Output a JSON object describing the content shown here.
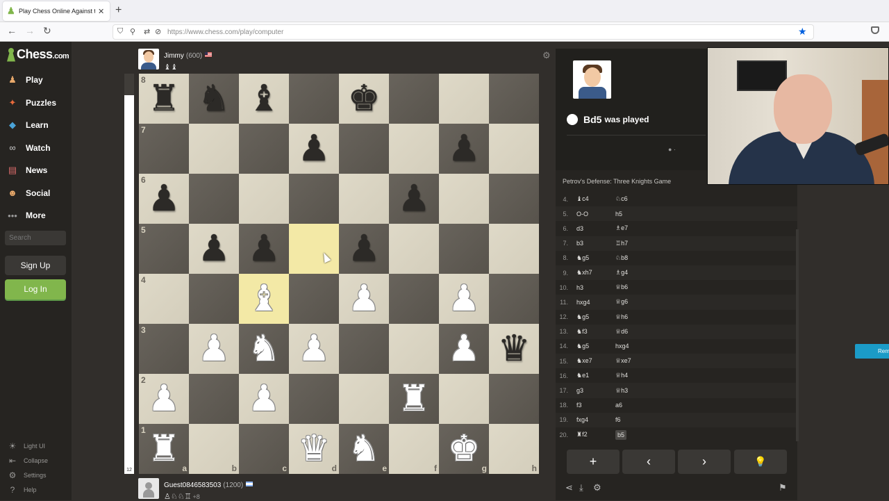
{
  "browser": {
    "tab_title": "Play Chess Online Against the C",
    "url": "https://www.chess.com/play/computer"
  },
  "sidebar": {
    "logo": "Chess",
    "logo_suffix": ".com",
    "items": [
      {
        "label": "Play",
        "icon": "pawn-hand-icon",
        "color": "#e8a86a"
      },
      {
        "label": "Puzzles",
        "icon": "puzzle-icon",
        "color": "#e86a3c"
      },
      {
        "label": "Learn",
        "icon": "mortarboard-icon",
        "color": "#4aa3d8"
      },
      {
        "label": "Watch",
        "icon": "binoculars-icon",
        "color": "#cccccc"
      },
      {
        "label": "News",
        "icon": "newspaper-icon",
        "color": "#d86a6a"
      },
      {
        "label": "Social",
        "icon": "people-icon",
        "color": "#e8a86a"
      },
      {
        "label": "More",
        "icon": "more-dots-icon",
        "color": "#999999"
      }
    ],
    "search_placeholder": "Search",
    "signup": "Sign Up",
    "login": "Log In",
    "footer": [
      {
        "label": "Light UI",
        "icon": "lightbulb-icon"
      },
      {
        "label": "Collapse",
        "icon": "collapse-icon"
      },
      {
        "label": "Settings",
        "icon": "gear-icon"
      },
      {
        "label": "Help",
        "icon": "help-icon"
      }
    ]
  },
  "top_player": {
    "name": "Jimmy",
    "rating": "(600)",
    "captured": "♝♝"
  },
  "bottom_player": {
    "name": "Guest0846583503",
    "rating": "(1200)",
    "captured": "♙♘♘♖",
    "advantage": "+8"
  },
  "eval": {
    "score": "12",
    "white_fraction": 0.946
  },
  "board": {
    "ranks": [
      "8",
      "7",
      "6",
      "5",
      "4",
      "3",
      "2",
      "1"
    ],
    "files": [
      "a",
      "b",
      "c",
      "d",
      "e",
      "f",
      "g",
      "h"
    ],
    "highlights": [
      "d5",
      "c4"
    ],
    "pieces": [
      {
        "sq": "a8",
        "p": "♜",
        "c": "b"
      },
      {
        "sq": "b8",
        "p": "♞",
        "c": "b"
      },
      {
        "sq": "c8",
        "p": "♝",
        "c": "b"
      },
      {
        "sq": "e8",
        "p": "♚",
        "c": "b"
      },
      {
        "sq": "d7",
        "p": "♟",
        "c": "b"
      },
      {
        "sq": "g7",
        "p": "♟",
        "c": "b"
      },
      {
        "sq": "a6",
        "p": "♟",
        "c": "b"
      },
      {
        "sq": "f6",
        "p": "♟",
        "c": "b"
      },
      {
        "sq": "b5",
        "p": "♟",
        "c": "b"
      },
      {
        "sq": "c5",
        "p": "♟",
        "c": "b"
      },
      {
        "sq": "e5",
        "p": "♟",
        "c": "b"
      },
      {
        "sq": "c4",
        "p": "♝",
        "c": "w"
      },
      {
        "sq": "e4",
        "p": "♟",
        "c": "w"
      },
      {
        "sq": "g4",
        "p": "♟",
        "c": "w"
      },
      {
        "sq": "b3",
        "p": "♟",
        "c": "w"
      },
      {
        "sq": "c3",
        "p": "♞",
        "c": "w"
      },
      {
        "sq": "d3",
        "p": "♟",
        "c": "w"
      },
      {
        "sq": "g3",
        "p": "♟",
        "c": "w"
      },
      {
        "sq": "h3",
        "p": "♛",
        "c": "b"
      },
      {
        "sq": "a2",
        "p": "♟",
        "c": "w"
      },
      {
        "sq": "c2",
        "p": "♟",
        "c": "w"
      },
      {
        "sq": "f2",
        "p": "♜",
        "c": "w"
      },
      {
        "sq": "a1",
        "p": "♜",
        "c": "w"
      },
      {
        "sq": "d1",
        "p": "♛",
        "c": "w"
      },
      {
        "sq": "e1",
        "p": "♞",
        "c": "w"
      },
      {
        "sq": "g1",
        "p": "♚",
        "c": "w"
      }
    ]
  },
  "panel": {
    "last_move": "Bd5",
    "last_move_text": "was played",
    "dots": "● ·",
    "opening": "Petrov's Defense: Three Knights Game",
    "moves": [
      {
        "n": "4.",
        "w": "♝c4",
        "b": "♘c6"
      },
      {
        "n": "5.",
        "w": "O-O",
        "b": "h5"
      },
      {
        "n": "6.",
        "w": "d3",
        "b": "♗e7"
      },
      {
        "n": "7.",
        "w": "b3",
        "b": "♖h7"
      },
      {
        "n": "8.",
        "w": "♞g5",
        "b": "♘b8"
      },
      {
        "n": "9.",
        "w": "♞xh7",
        "b": "♗g4"
      },
      {
        "n": "10.",
        "w": "h3",
        "b": "♕b6"
      },
      {
        "n": "11.",
        "w": "hxg4",
        "b": "♕g6"
      },
      {
        "n": "12.",
        "w": "♞g5",
        "b": "♕h6"
      },
      {
        "n": "13.",
        "w": "♞f3",
        "b": "♕d6"
      },
      {
        "n": "14.",
        "w": "♞g5",
        "b": "hxg4"
      },
      {
        "n": "15.",
        "w": "♞xe7",
        "b": "♕xe7"
      },
      {
        "n": "16.",
        "w": "♞e1",
        "b": "♕h4"
      },
      {
        "n": "17.",
        "w": "g3",
        "b": "♕h3"
      },
      {
        "n": "18.",
        "w": "f3",
        "b": "a6"
      },
      {
        "n": "19.",
        "w": "fxg4",
        "b": "f6"
      },
      {
        "n": "20.",
        "w": "♜f2",
        "b": "b5"
      }
    ],
    "controls": [
      "+",
      "‹",
      "›",
      "💡"
    ]
  },
  "remind": "Remind"
}
